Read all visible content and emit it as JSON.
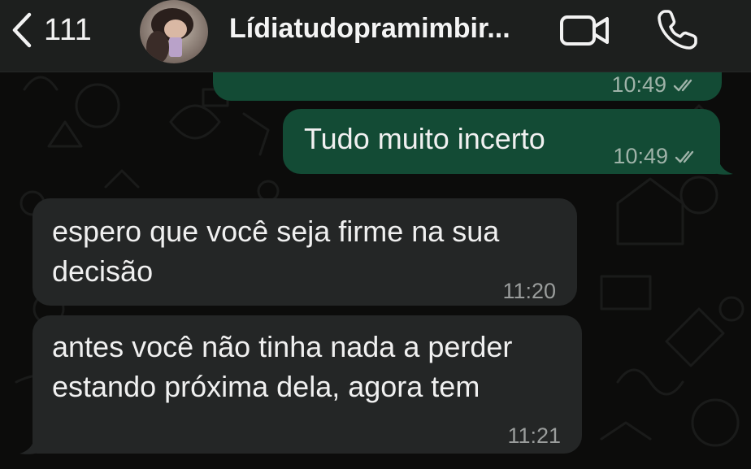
{
  "header": {
    "back_count": "111",
    "contact_name": "Lídiatudopramimbir...",
    "icons": {
      "back": "chevron-left-icon",
      "video": "video-camera-icon",
      "call": "phone-icon"
    }
  },
  "messages": [
    {
      "direction": "outgoing",
      "text": "",
      "time": "10:49",
      "status": "read"
    },
    {
      "direction": "outgoing",
      "text": "Tudo muito incerto",
      "time": "10:49",
      "status": "read"
    },
    {
      "direction": "incoming",
      "lines": [
        "espero que você seja firme na sua",
        "decisão"
      ],
      "time": "11:20"
    },
    {
      "direction": "incoming",
      "lines": [
        "antes você não tinha nada a perder",
        "estando próxima dela, agora tem"
      ],
      "time": "11:21"
    }
  ],
  "colors": {
    "outgoing_bubble": "#134b35",
    "incoming_bubble": "#242626",
    "header": "#1d1f1e",
    "background": "#0c0c0b"
  }
}
